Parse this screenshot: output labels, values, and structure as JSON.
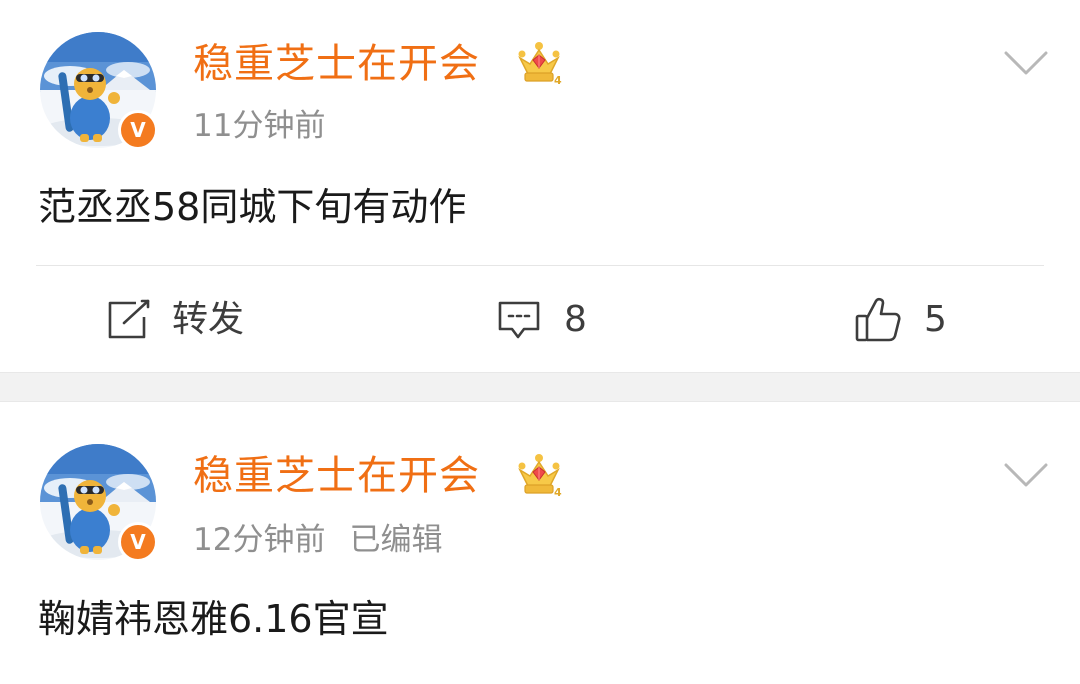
{
  "posts": [
    {
      "author": "稳重芝士在开会",
      "verified_badge": "V",
      "time": "11分钟前",
      "text": "范丞丞58同城下旬有动作",
      "actions": {
        "repost_icon": "edit-square-icon",
        "repost_label": "转发",
        "comment_icon": "comment-icon",
        "comment_count": "8",
        "like_icon": "thumbs-up-icon",
        "like_count": "5"
      }
    },
    {
      "author": "稳重芝士在开会",
      "verified_badge": "V",
      "time": "12分钟前",
      "edited": "已编辑",
      "text": "鞠婧祎恩雅6.16官宣"
    }
  ],
  "colors": {
    "username": "#f06f14",
    "badge": "#f47b20",
    "meta": "#8f8f8f",
    "text": "#1a1a1a",
    "separator": "#f2f2f2"
  },
  "icons": {
    "member_crown": "crown-icon",
    "menu": "chevron-down-icon"
  }
}
